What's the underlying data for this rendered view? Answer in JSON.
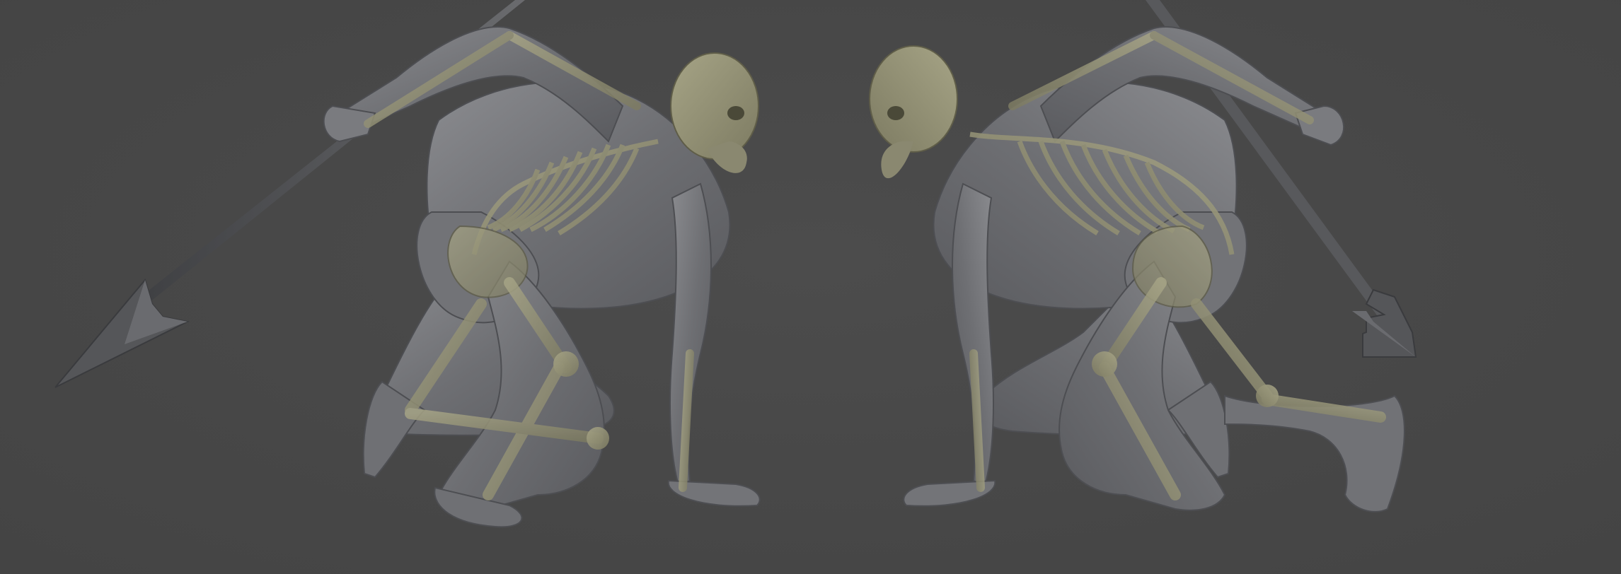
{
  "scene": {
    "background_color": "#484848",
    "muscle_color": "#7d7e82",
    "bone_color": "#8e8c70",
    "spear_color": "#5e5f62",
    "description_icons": [
      "anatomy-figure-left",
      "anatomy-figure-right"
    ]
  }
}
